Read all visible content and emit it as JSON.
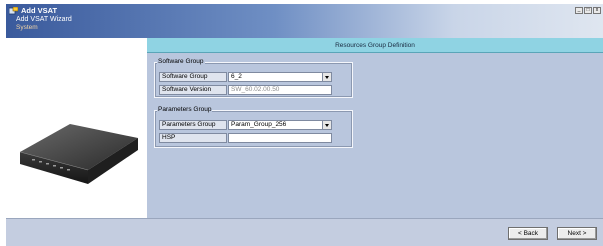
{
  "window": {
    "app_title": "Add VSAT",
    "wizard_title": "Add VSAT Wizard",
    "wizard_subtitle": "System",
    "controls": {
      "minimize": "_",
      "maximize": "□",
      "close": "x"
    }
  },
  "main": {
    "header_title": "Resources Group Definition",
    "software_group": {
      "legend": "Software Group",
      "group_label": "Software Group",
      "group_value": "6_2",
      "version_label": "Software Version",
      "version_value": "SW_60.02.00.50"
    },
    "parameters_group": {
      "legend": "Parameters Group",
      "group_label": "Parameters Group",
      "group_value": "Param_Group_256",
      "hsp_label": "HSP",
      "hsp_value": ""
    }
  },
  "footer": {
    "back_label": "< Back",
    "next_label": "Next >"
  },
  "colors": {
    "titlebar_start": "#3a5a9c",
    "header_bar": "#8fd3e3",
    "panel_bg": "#b9c6dd",
    "footer_bg": "#c4cde0"
  },
  "icons": {
    "app": "vsat-app-icon",
    "device": "vsat-modem-image"
  }
}
